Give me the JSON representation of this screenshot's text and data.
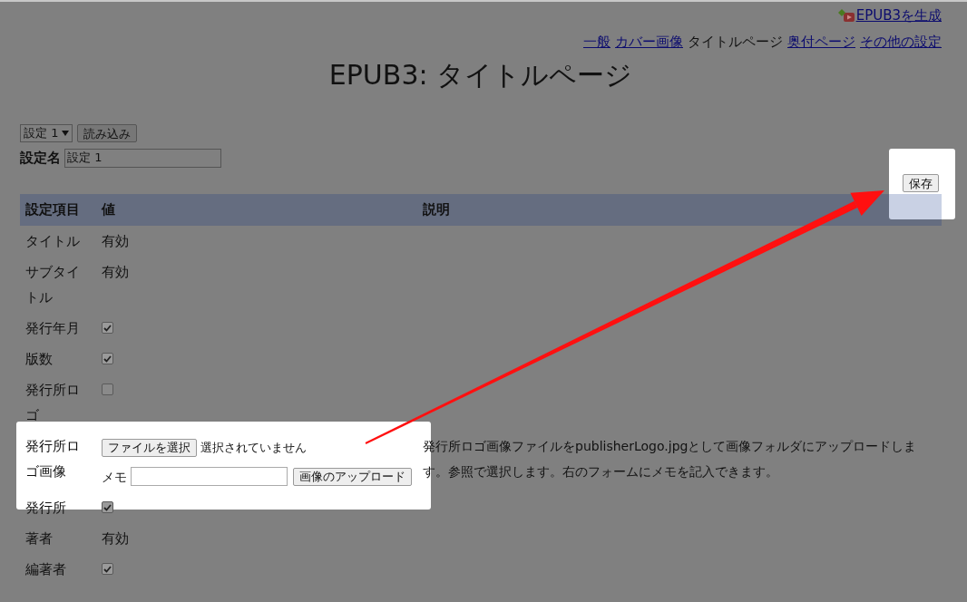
{
  "generate_link": {
    "label": "EPUB3を生成"
  },
  "nav": [
    {
      "label": "一般",
      "selected": false
    },
    {
      "label": "カバー画像",
      "selected": false
    },
    {
      "label": "タイトルページ",
      "selected": true
    },
    {
      "label": "奥付ページ",
      "selected": false
    },
    {
      "label": "その他の設定",
      "selected": false
    }
  ],
  "title": "EPUB3: タイトルページ",
  "preset_select": {
    "value": "設定 1"
  },
  "load_button": "読み込み",
  "preset_name": {
    "label": "設定名",
    "value": "設定 1"
  },
  "save_button": "保存",
  "table": {
    "columns": [
      "設定項目",
      "値",
      "説明"
    ],
    "rows": [
      {
        "name": "タイトル",
        "kind": "text",
        "value": "有効"
      },
      {
        "name": "サブタイトル",
        "kind": "text",
        "value": "有効"
      },
      {
        "name": "発行年月",
        "kind": "checkbox",
        "checked": true
      },
      {
        "name": "版数",
        "kind": "checkbox",
        "checked": true
      },
      {
        "name": "発行所ロゴ",
        "kind": "checkbox",
        "checked": false
      },
      {
        "name": "発行所ロゴ画像",
        "kind": "file",
        "file_button": "ファイルを選択",
        "file_status": "選択されていません",
        "memo_label": "メモ",
        "upload_button": "画像のアップロード",
        "description": "発行所ロゴ画像ファイルをpublisherLogo.jpgとして画像フォルダにアップロードします。参照で選択します。右のフォームにメモを記入できます。"
      },
      {
        "name": "発行所",
        "kind": "checkbox",
        "checked": true
      },
      {
        "name": "著者",
        "kind": "text",
        "value": "有効"
      },
      {
        "name": "編著者",
        "kind": "checkbox",
        "checked": true
      }
    ]
  }
}
